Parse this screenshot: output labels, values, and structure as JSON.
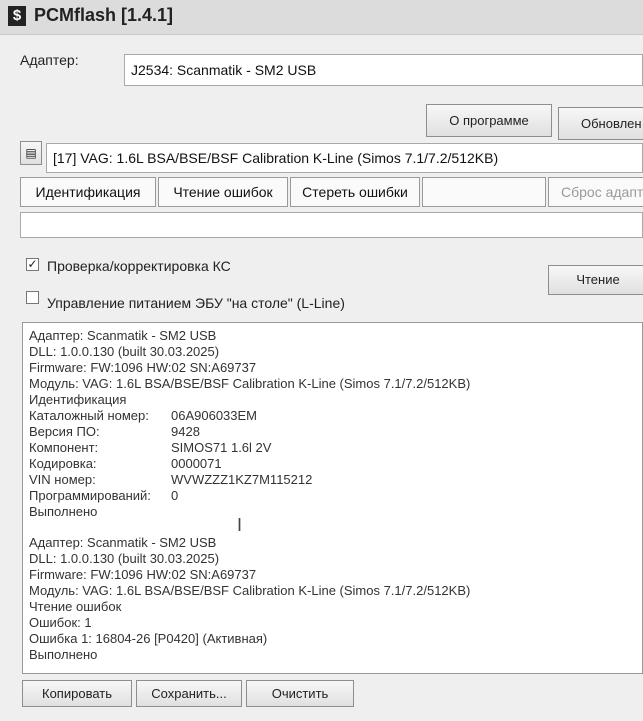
{
  "window": {
    "app_icon": "pcmflash-logo-icon",
    "title": "PCMflash [1.4.1]"
  },
  "adapter": {
    "label": "Адаптер:",
    "value": "J2534: Scanmatik - SM2 USB"
  },
  "top_buttons": {
    "about": "О программе",
    "update": "Обновлен"
  },
  "module": {
    "icon": "module-list-icon",
    "value": "[17] VAG: 1.6L BSA/BSE/BSF Calibration K-Line (Simos 7.1/7.2/512KB)"
  },
  "tabs": [
    {
      "label": "Идентификация"
    },
    {
      "label": "Чтение ошибок"
    },
    {
      "label": "Стереть ошибки"
    },
    {
      "label": ""
    },
    {
      "label": "Сброс адапта"
    }
  ],
  "status_field": {
    "value": ""
  },
  "options": {
    "checksum": {
      "label": "Проверка/корректировка КС",
      "checked": true
    },
    "power": {
      "label": "Управление питанием ЭБУ \"на столе\" (L-Line)",
      "checked": false
    },
    "read_button": "Чтение"
  },
  "log": {
    "block1": [
      "Адаптер: Scanmatik - SM2 USB",
      "DLL: 1.0.0.130 (built 30.03.2025)",
      "Firmware: FW:1096 HW:02 SN:A69737",
      "Модуль: VAG: 1.6L BSA/BSE/BSF Calibration K-Line (Simos 7.1/7.2/512KB)",
      "Идентификация"
    ],
    "ident": [
      {
        "key": "Каталожный номер:",
        "value": "06A906033EM"
      },
      {
        "key": "Версия ПО:",
        "value": "9428"
      },
      {
        "key": "Компонент:",
        "value": "SIMOS71 1.6l 2V"
      },
      {
        "key": "Кодировка:",
        "value": "0000071"
      },
      {
        "key": "VIN номер:",
        "value": "WVWZZZ1KZ7M115212"
      },
      {
        "key": "Программирований:",
        "value": "0"
      }
    ],
    "done1": "Выполнено",
    "block2": [
      "Адаптер: Scanmatik - SM2 USB",
      "DLL: 1.0.0.130 (built 30.03.2025)",
      "Firmware: FW:1096 HW:02 SN:A69737",
      "Модуль: VAG: 1.6L BSA/BSE/BSF Calibration K-Line (Simos 7.1/7.2/512KB)",
      "Чтение ошибок",
      "Ошибок: 1",
      "Ошибка  1: 16804-26 [P0420] (Активная)",
      "Выполнено"
    ],
    "cursor_icon": "text-cursor-icon"
  },
  "bottom_buttons": {
    "copy": "Копировать",
    "save": "Сохранить...",
    "clear": "Очистить"
  }
}
